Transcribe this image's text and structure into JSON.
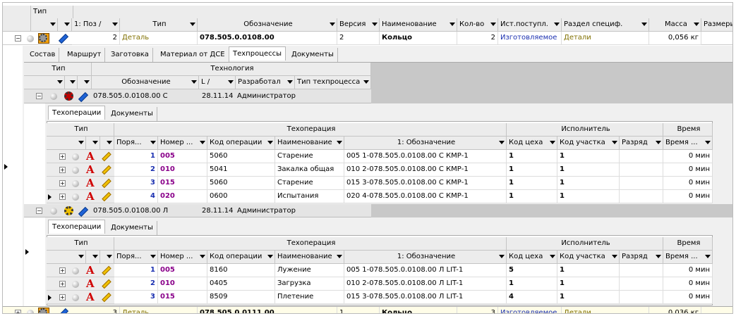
{
  "main": {
    "group_label": "Тип",
    "columns": [
      "1: Поз",
      "Тип",
      "Обозначение",
      "Версия",
      "Наименование",
      "Кол-во",
      "Ист.поступл.",
      "Раздел специф.",
      "Масса",
      "Размеры"
    ],
    "rows": [
      {
        "pos": "2",
        "type": "Деталь",
        "designation": "078.505.0.0108.00",
        "version": "2",
        "name": "Кольцо",
        "qty": "2",
        "source": "Изготовляемое",
        "section": "Детали",
        "mass": "0,056 кг"
      },
      {
        "pos": "3",
        "type": "Деталь",
        "designation": "078.505.0.0111.00",
        "version": "1",
        "name": "Кольцо",
        "qty": "3",
        "source": "Изготовляемое",
        "section": "Детали",
        "mass": "0,036 кг"
      }
    ]
  },
  "detail_tabs": [
    "Состав",
    "Маршрут",
    "Заготовка",
    "Материал от ДСЕ",
    "Техпроцессы",
    "Документы"
  ],
  "tech": {
    "group_type": "Тип",
    "group_tech": "Технология",
    "columns": [
      "Обозначение",
      "L",
      "Разработал",
      "Тип техпроцесса"
    ],
    "processes": [
      {
        "designation": "078.505.0.0108.00 С",
        "date": "28.11.14",
        "developer": "Администратор",
        "tabs": [
          "Техоперации",
          "Документы"
        ],
        "ops": [
          {
            "order": "1",
            "number": "005",
            "code": "5060",
            "name": "Старение",
            "oboz": "005 1-078.505.0.0108.00 С КМР-1",
            "shop": "1",
            "area": "1",
            "time": "0 мин"
          },
          {
            "order": "2",
            "number": "010",
            "code": "5041",
            "name": "Закалка общая",
            "oboz": "010 2-078.505.0.0108.00 С КМР-1",
            "shop": "1",
            "area": "1",
            "time": "0 мин"
          },
          {
            "order": "3",
            "number": "015",
            "code": "5060",
            "name": "Старение",
            "oboz": "015 3-078.505.0.0108.00 С КМР-1",
            "shop": "1",
            "area": "1",
            "time": "0 мин"
          },
          {
            "order": "4",
            "number": "020",
            "code": "0600",
            "name": "Испытания",
            "oboz": "020 4-078.505.0.0108.00 С КМР-1",
            "shop": "1",
            "area": "1",
            "time": "0 мин"
          }
        ]
      },
      {
        "designation": "078.505.0.0108.00 Л",
        "date": "28.11.14",
        "developer": "Администратор",
        "tabs": [
          "Техоперации",
          "Документы"
        ],
        "ops": [
          {
            "order": "1",
            "number": "005",
            "code": "8160",
            "name": "Лужение",
            "oboz": "005 1-078.505.0.0108.00 Л LIT-1",
            "shop": "5",
            "area": "1",
            "time": "0 мин"
          },
          {
            "order": "2",
            "number": "010",
            "code": "0405",
            "name": "Загрузка",
            "oboz": "010 2-078.505.0.0108.00 Л LIT-1",
            "shop": "1",
            "area": "1",
            "time": "0 мин"
          },
          {
            "order": "3",
            "number": "015",
            "code": "8509",
            "name": "Плетение",
            "oboz": "015 3-078.505.0.0108.00 Л LIT-1",
            "shop": "4",
            "area": "1",
            "time": "0 мин"
          }
        ]
      }
    ]
  },
  "ops_header": {
    "group_type": "Тип",
    "group_op": "Техоперация",
    "group_exec": "Исполнитель",
    "group_time": "Время",
    "columns": [
      "Поря...",
      "Номер ...",
      "Код операции",
      "Наименование",
      "1: Обозначение",
      "Код цеха",
      "Код участка",
      "Разряд",
      "Время ..."
    ]
  }
}
